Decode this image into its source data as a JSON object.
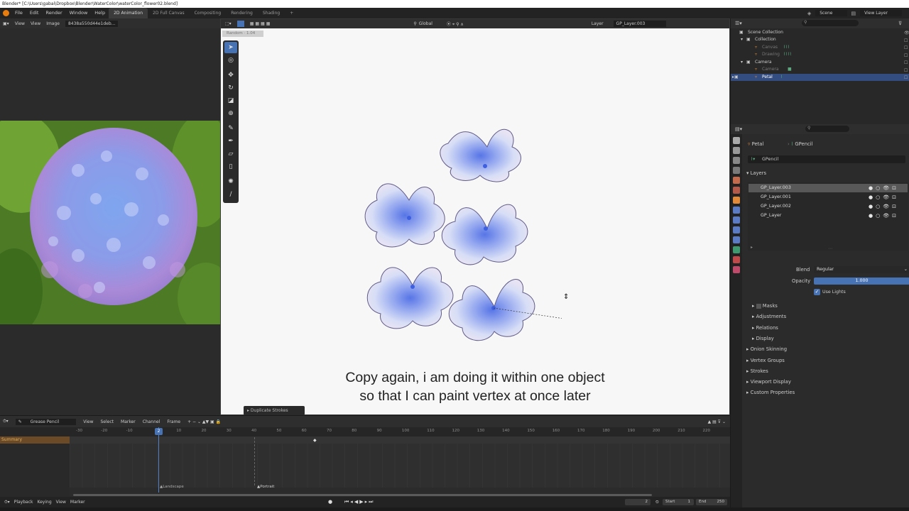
{
  "window_title": "Blender* [C:\\Users\\gabai\\Dropbox\\Blender\\WaterColor\\waterColor_flower02.blend]",
  "menu": [
    "File",
    "Edit",
    "Render",
    "Window",
    "Help"
  ],
  "workspaces": [
    "2D Animation",
    "2D Full Canvas",
    "Compositing",
    "Rendering",
    "Shading"
  ],
  "workspace_add": "+",
  "scene": {
    "label": "Scene",
    "view_layer": "View Layer"
  },
  "image_editor": {
    "view": "View",
    "view2": "View",
    "image": "Image",
    "image_name": "8438a550d44e1deb..."
  },
  "viewport": {
    "mode_label": "Global",
    "layer_label": "Layer",
    "layer_value": "GP_Layer.003",
    "cursor_tag": "Random · 1.04",
    "operator_label": "Duplicate Strokes",
    "subtitle_line1": "Copy again, i am doing it within one object",
    "subtitle_line2": "so that I can paint vertex at once later",
    "tools": [
      "select-tool",
      "cursor-tool",
      "move-tool",
      "rotate-tool",
      "scale-tool",
      "transform-tool",
      "draw-tool",
      "tint-tool",
      "box-tool",
      "polyline-tool",
      "eyedropper-tool",
      "measure-tool"
    ]
  },
  "outliner": {
    "rows": [
      {
        "label": "Scene Collection",
        "indent": 0,
        "dim": false,
        "selected": false
      },
      {
        "label": "Collection",
        "indent": 1,
        "dim": false,
        "selected": false
      },
      {
        "label": "Canvas",
        "indent": 2,
        "dim": true,
        "selected": false
      },
      {
        "label": "Drawing",
        "indent": 2,
        "dim": true,
        "selected": false
      },
      {
        "label": "Camera",
        "indent": 1,
        "dim": false,
        "selected": false
      },
      {
        "label": "Camera",
        "indent": 2,
        "dim": true,
        "selected": false
      },
      {
        "label": "Petal",
        "indent": 2,
        "dim": false,
        "selected": true
      }
    ]
  },
  "properties": {
    "object_name": "Petal",
    "data_name": "GPencil",
    "data_field": "GPencil",
    "layers_title": "Layers",
    "layers": [
      "GP_Layer.003",
      "GP_Layer.001",
      "GP_Layer.002",
      "GP_Layer"
    ],
    "blend_label": "Blend",
    "blend_value": "Regular",
    "opacity_label": "Opacity",
    "opacity_value": "1.000",
    "opacity_fraction": 1.0,
    "use_lights_label": "Use Lights",
    "sub_panels": [
      "Masks",
      "Adjustments",
      "Relations",
      "Display"
    ],
    "panels": [
      "Onion Skinning",
      "Vertex Groups",
      "Strokes",
      "Viewport Display",
      "Custom Properties"
    ]
  },
  "timeline": {
    "mode": "Grease Pencil",
    "menus": [
      "View",
      "Select",
      "Marker",
      "Channel",
      "Frame"
    ],
    "summary": "Summary",
    "current_frame": "2",
    "ticks": [
      "-30",
      "-20",
      "-10",
      "2",
      "10",
      "20",
      "30",
      "40",
      "50",
      "60",
      "70",
      "80",
      "90",
      "100",
      "110",
      "120",
      "130",
      "140",
      "150",
      "160",
      "170",
      "180",
      "190",
      "200",
      "210",
      "220"
    ],
    "markers": [
      "Landscape",
      "Portrait"
    ],
    "playback_menus": [
      "Playback",
      "Keying",
      "View",
      "Marker"
    ],
    "frame_field": "2",
    "start_label": "Start",
    "start_value": "1",
    "end_label": "End",
    "end_value": "250"
  }
}
